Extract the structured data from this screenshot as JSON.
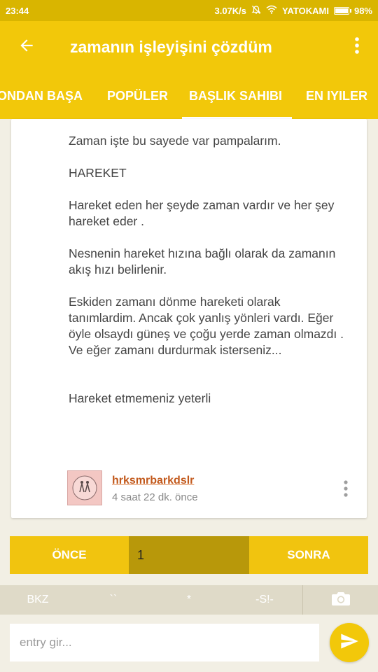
{
  "status_bar": {
    "time": "23:44",
    "network_speed": "3.07K/s",
    "carrier": "YATOKAMI",
    "battery": "98%",
    "battery_level": 0.98,
    "icons": [
      "mute-icon",
      "wifi-icon",
      "battery-icon"
    ]
  },
  "app_bar": {
    "title": "zamanın işleyişini çözdüm",
    "back_icon": "arrow-left-icon",
    "more_icon": "more-vert-icon"
  },
  "tabs": [
    {
      "label": "ONDAN BAŞA",
      "active": false
    },
    {
      "label": "POPÜLER",
      "active": false
    },
    {
      "label": "BAŞLIK SAHIBI",
      "active": true
    },
    {
      "label": "EN IYILER",
      "active": false
    }
  ],
  "entry": {
    "paragraphs": [
      "Zaman işte bu sayede var pampalarım.",
      "HAREKET",
      "Hareket eden her şeyde zaman vardır ve her şey hareket eder .",
      "Nesnenin hareket hızına bağlı olarak da zamanın akış hızı belirlenir.",
      "Eskiden zamanı dönme hareketi olarak tanımlardim. Ancak çok yanlış yönleri vardı. Eğer öyle olsaydı güneş ve çoğu yerde zaman olmazdı . Ve eğer zamanı durdurmak isterseniz...",
      "Hareket etmemeniz yeterli"
    ],
    "author": "hrksmrbarkdslr",
    "time": "4 saat 22 dk. önce"
  },
  "pager": {
    "prev_label": "ÖNCE",
    "page_value": "1",
    "next_label": "SONRA"
  },
  "toolbar": {
    "items": [
      "BKZ",
      "``",
      "*",
      "-S!-"
    ],
    "camera_icon": "camera-icon"
  },
  "composer": {
    "placeholder": "entry gir...",
    "send_icon": "send-icon"
  },
  "colors": {
    "accent": "#f2c80a",
    "status_bar": "#d9b500",
    "author_link": "#c2591c",
    "background": "#f2efe4"
  }
}
